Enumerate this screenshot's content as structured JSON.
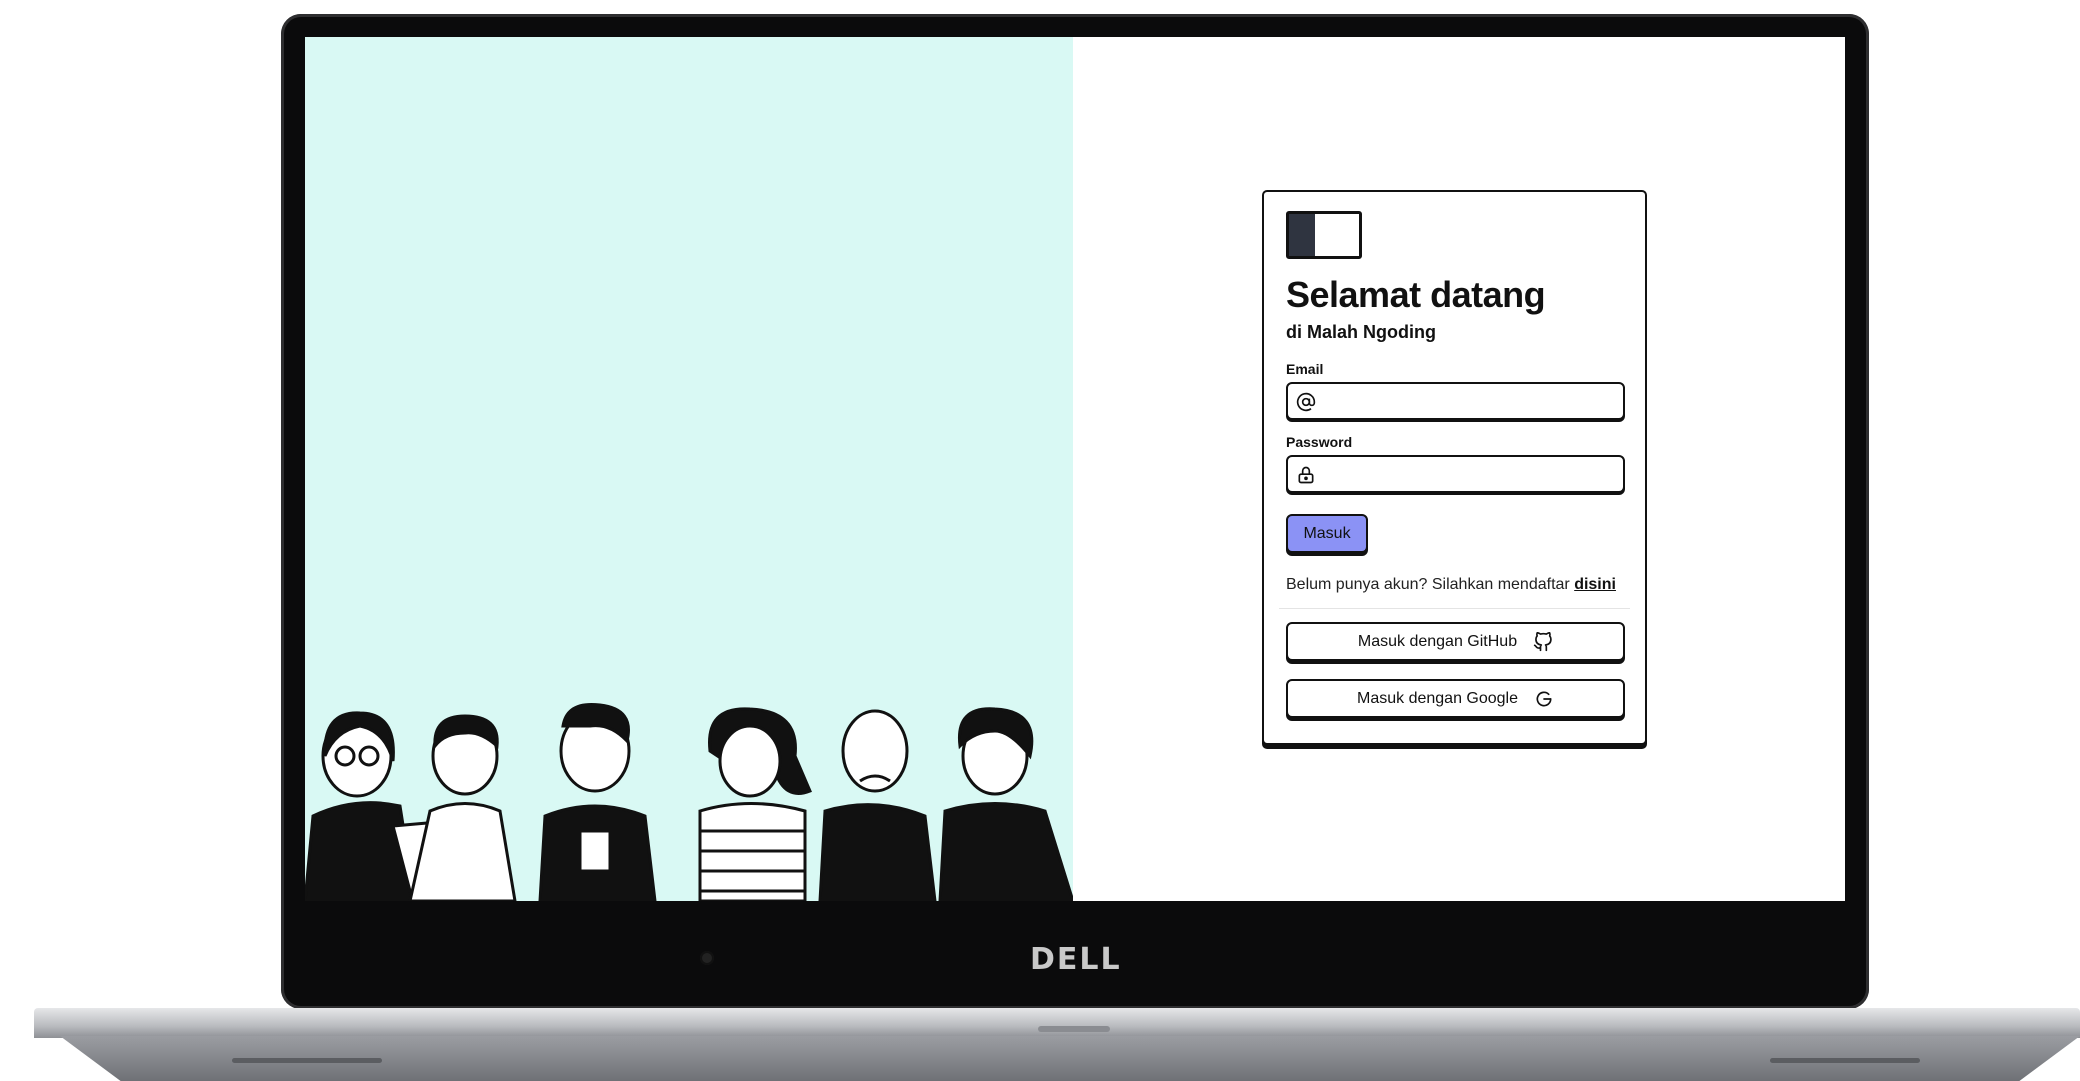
{
  "device": {
    "brand": "DELL"
  },
  "login": {
    "title": "Selamat datang",
    "subtitle": "di Malah Ngoding",
    "email_label": "Email",
    "email_value": "",
    "password_label": "Password",
    "password_value": "",
    "submit_label": "Masuk",
    "register_text": "Belum punya akun? Silahkan mendaftar",
    "register_link": "disini",
    "github_label": "Masuk dengan GitHub",
    "google_label": "Masuk dengan Google"
  },
  "icons": {
    "email": "at-icon",
    "password": "lock-icon",
    "github": "github-icon",
    "google": "google-icon",
    "logo": "sidebar-logo-icon"
  },
  "colors": {
    "illustration_bg": "#d9f9f4",
    "primary_button": "#8b92f5",
    "logo_fill": "#2f3440",
    "border": "#111111"
  }
}
